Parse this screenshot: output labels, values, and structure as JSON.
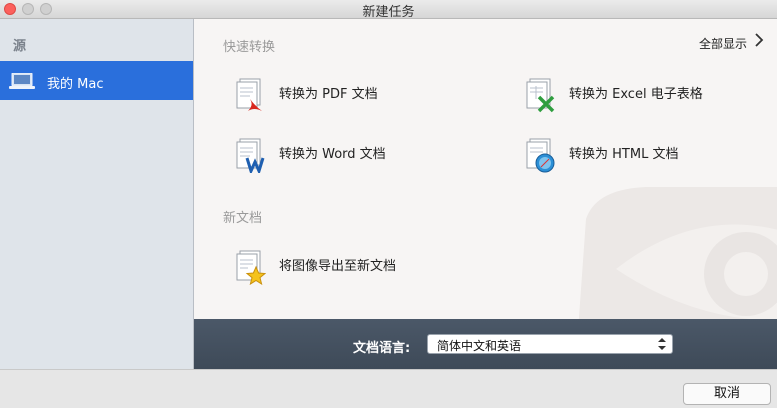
{
  "window": {
    "title": "新建任务"
  },
  "sidebar": {
    "header": "源",
    "items": [
      {
        "label": "我的 Mac",
        "icon": "laptop-icon",
        "selected": true
      }
    ]
  },
  "main": {
    "quick": {
      "title": "快速转换",
      "show_all": "全部显示",
      "actions": [
        {
          "label": "转换为 PDF 文档",
          "icon": "pdf-document-icon"
        },
        {
          "label": "转换为 Excel 电子表格",
          "icon": "excel-document-icon"
        },
        {
          "label": "转换为 Word 文档",
          "icon": "word-document-icon"
        },
        {
          "label": "转换为 HTML 文档",
          "icon": "html-document-icon"
        }
      ]
    },
    "new_doc": {
      "title": "新文档",
      "actions": [
        {
          "label": "将图像导出至新文档",
          "icon": "image-star-document-icon"
        }
      ]
    }
  },
  "language": {
    "label": "文档语言:",
    "value": "简体中文和英语"
  },
  "footer": {
    "cancel_label": "取消"
  },
  "colors": {
    "accent": "#2a6fdc",
    "sidebar_bg": "#dfe4ea",
    "main_bg": "#f7f5f4",
    "langbar_bg": "#46525f"
  }
}
